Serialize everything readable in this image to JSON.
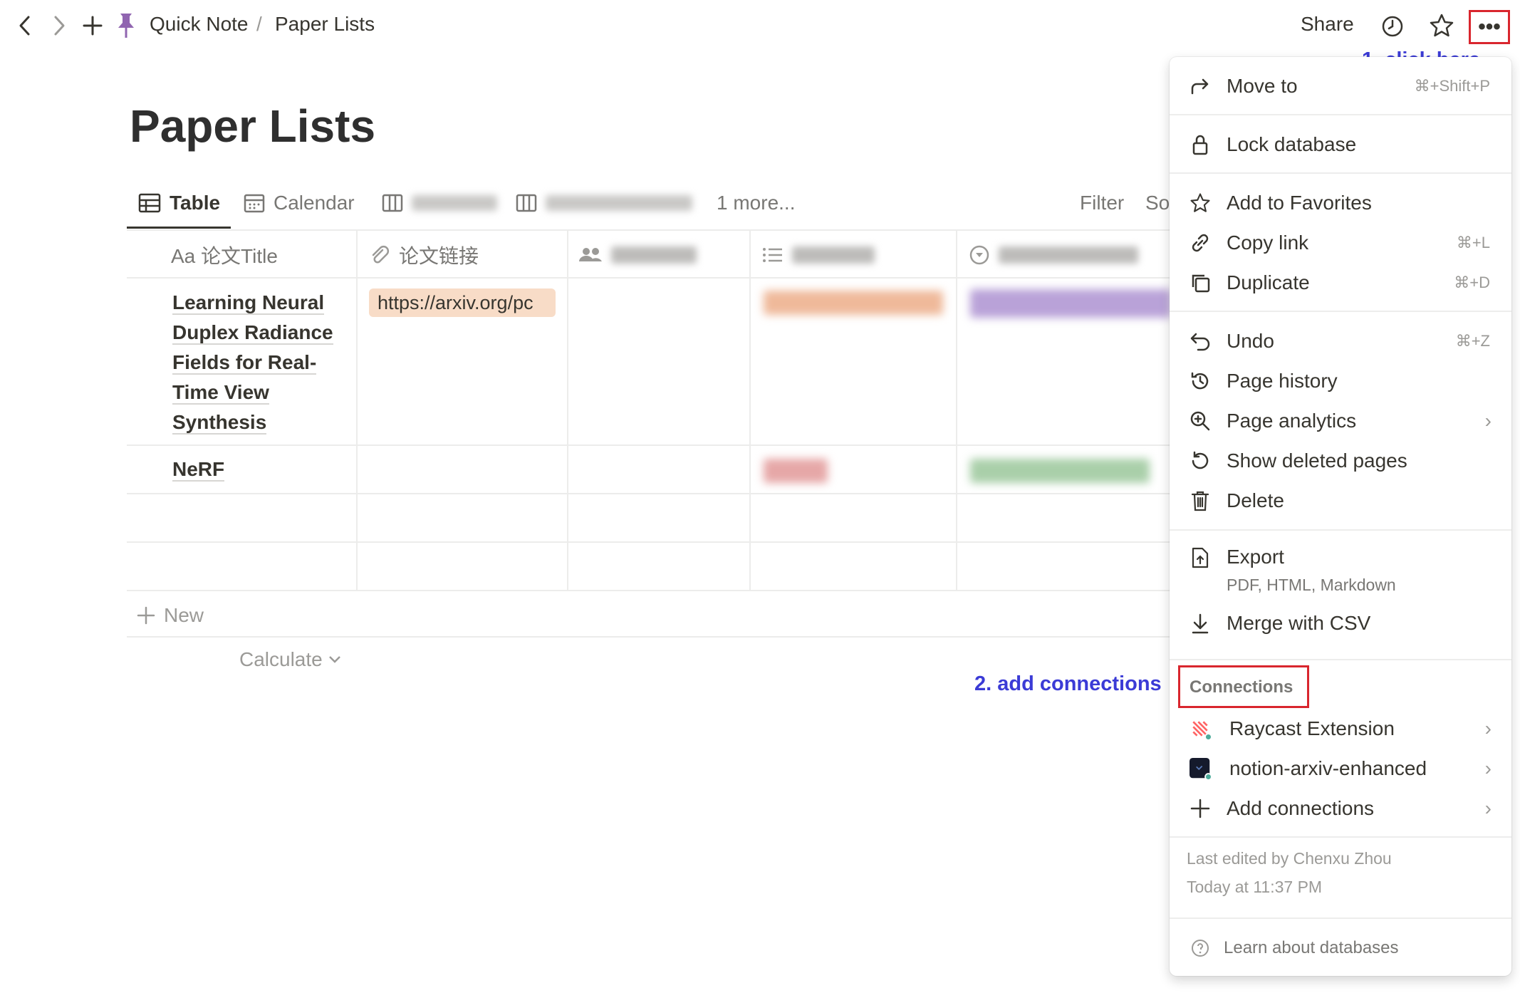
{
  "topbar": {
    "breadcrumb": [
      "Quick Note",
      "/",
      "Paper Lists"
    ],
    "share_label": "Share",
    "more_glyph": "•••"
  },
  "page": {
    "title": "Paper Lists"
  },
  "views": {
    "tabs": [
      "Table",
      "Calendar",
      "1 more..."
    ],
    "filter_label": "Filter",
    "sort_label_partial": "So"
  },
  "table": {
    "columns": [
      "Aa 论文Title",
      "论文链接"
    ],
    "rows": [
      {
        "title_lines": [
          "Learning Neural",
          "Duplex Radiance",
          "Fields for Real-",
          "Time View",
          "Synthesis"
        ],
        "link": "https://arxiv.org/pc"
      },
      {
        "title_lines": [
          "NeRF"
        ],
        "link": ""
      }
    ],
    "new_label": "New",
    "calculate_label": "Calculate"
  },
  "menu": {
    "move_to": {
      "label": "Move to",
      "shortcut": "⌘+Shift+P"
    },
    "lock": "Lock database",
    "favorites": "Add to Favorites",
    "copy_link": {
      "label": "Copy link",
      "shortcut": "⌘+L"
    },
    "duplicate": {
      "label": "Duplicate",
      "shortcut": "⌘+D"
    },
    "undo": {
      "label": "Undo",
      "shortcut": "⌘+Z"
    },
    "page_history": "Page history",
    "page_analytics": "Page analytics",
    "show_deleted": "Show deleted pages",
    "delete": "Delete",
    "export": {
      "label": "Export",
      "sub": "PDF, HTML, Markdown"
    },
    "merge_csv": "Merge with CSV",
    "connections_header": "Connections",
    "connections": [
      "Raycast Extension",
      "notion-arxiv-enhanced",
      "Add connections"
    ],
    "last_edited": "Last edited by Chenxu Zhou",
    "edited_time": "Today at 11:37 PM",
    "learn": "Learn about databases"
  },
  "annotations": {
    "step1": "1. click here",
    "step2": "2. add connections"
  },
  "colors": {
    "annotation_blue": "#3b3bd6",
    "highlight_red": "#d9262e",
    "url_chip_bg": "#f8dcc7"
  }
}
